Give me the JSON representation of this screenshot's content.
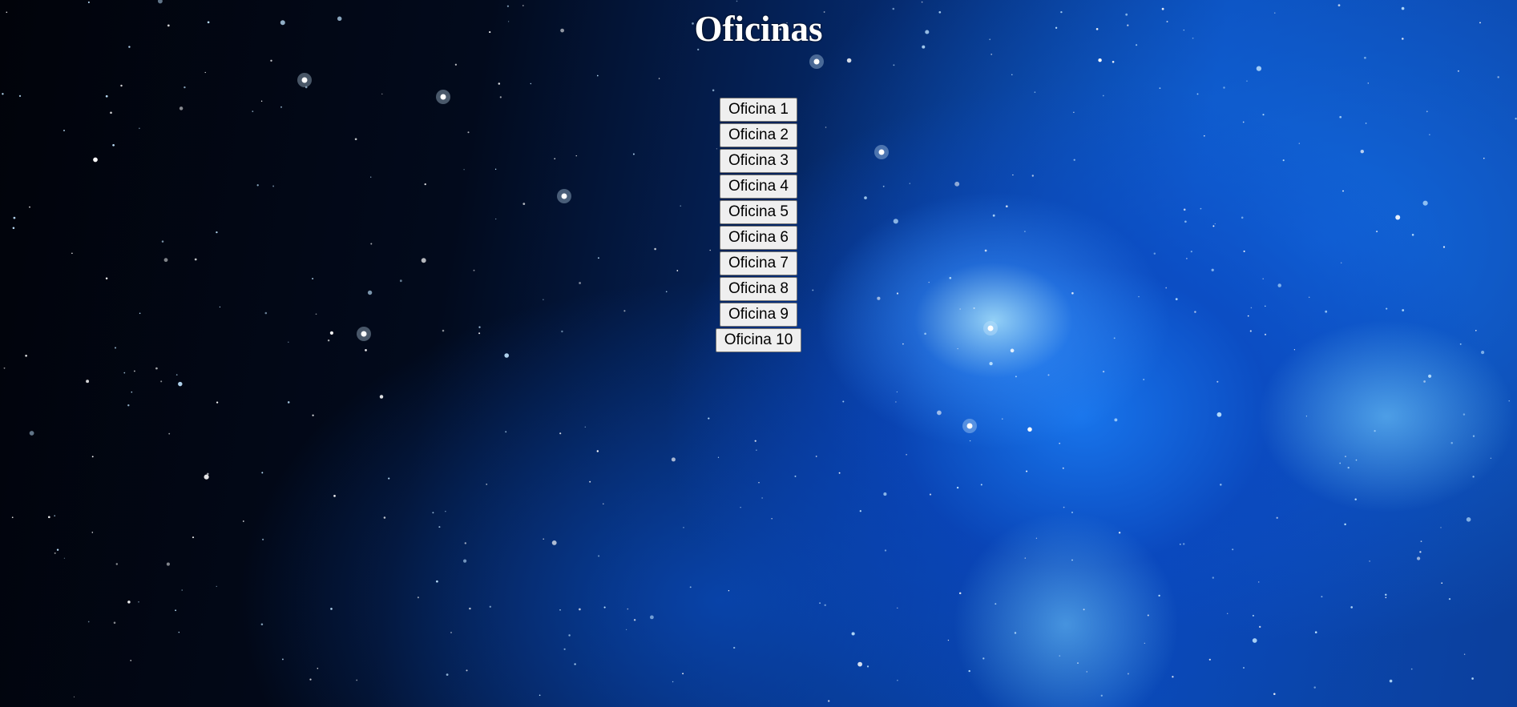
{
  "page": {
    "title": "Oficinas"
  },
  "offices": {
    "buttons": [
      "Oficina 1",
      "Oficina 2",
      "Oficina 3",
      "Oficina 4",
      "Oficina 5",
      "Oficina 6",
      "Oficina 7",
      "Oficina 8",
      "Oficina 9",
      "Oficina 10"
    ]
  },
  "colors": {
    "title": "#ffffff",
    "button_bg": "#efefef",
    "button_border": "#767676",
    "background_deep": "#01030a",
    "background_nebula": "#0a4bb8"
  }
}
